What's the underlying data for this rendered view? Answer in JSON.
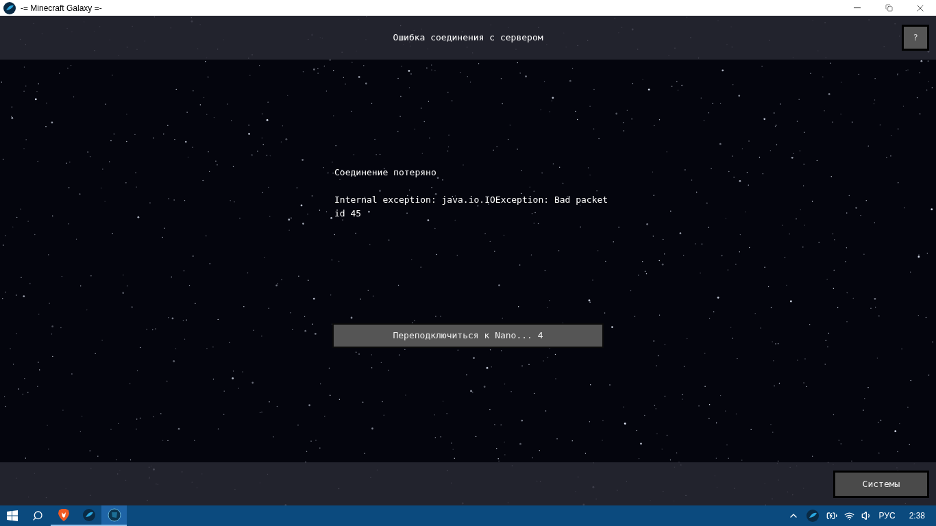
{
  "window": {
    "title": "-= Minecraft Galaxy =-"
  },
  "header": {
    "title": "Ошибка соединения с сервером",
    "help_button": "?"
  },
  "message": {
    "title": "Соединение потеряно",
    "detail": "Internal exception: java.io.IOException: Bad packet id 45"
  },
  "reconnect_button": "Переподключиться к Nano... 4",
  "footer": {
    "systems_button": "Системы"
  },
  "taskbar": {
    "apps": [
      {
        "kind": "browser",
        "selected": false
      },
      {
        "kind": "globe",
        "selected": false
      },
      {
        "kind": "game",
        "selected": true
      }
    ],
    "language": "РУС",
    "time": "2:38"
  }
}
